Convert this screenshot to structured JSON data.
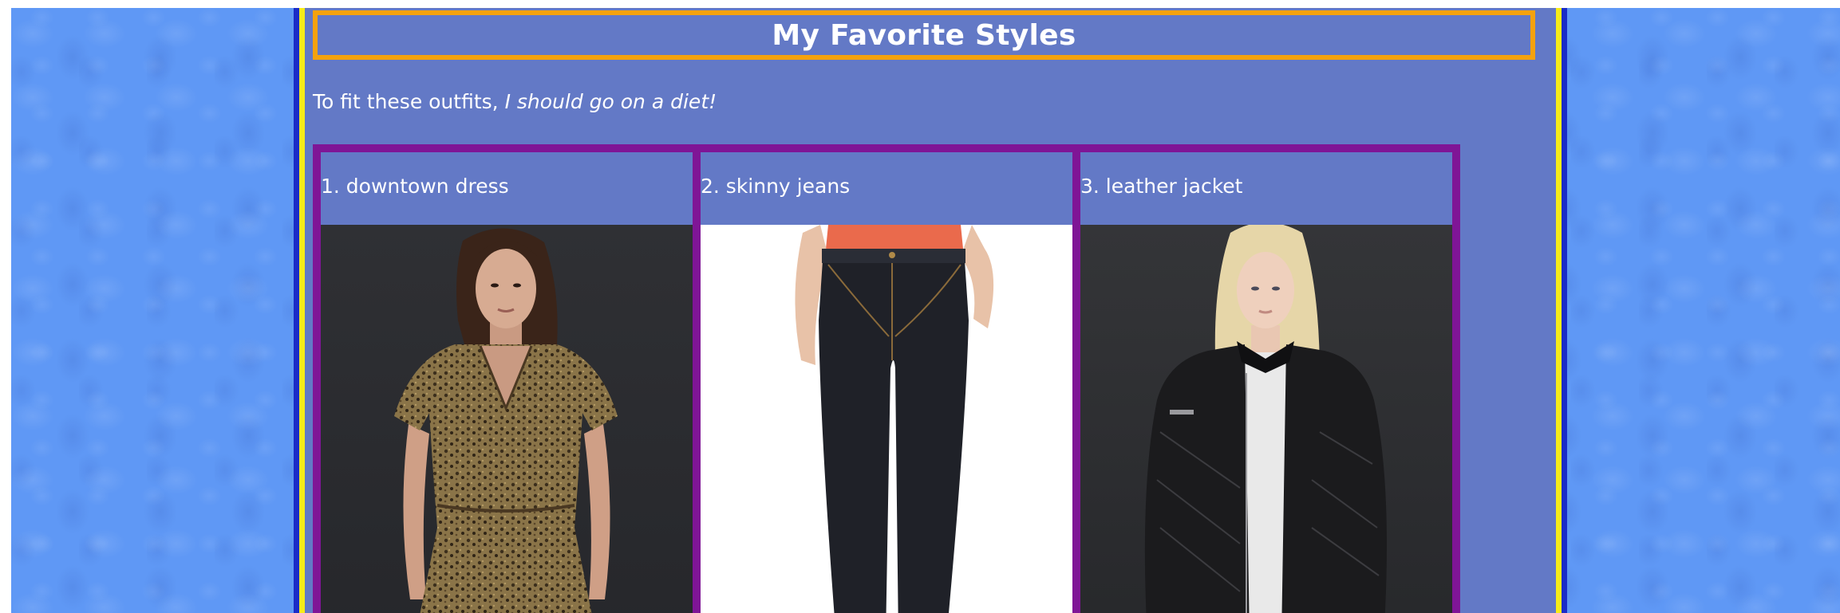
{
  "page": {
    "title": "My Favorite Styles",
    "intro_text": "To fit these outfits,",
    "intro_emphasis": "I should go on a diet!"
  },
  "items": [
    {
      "label": "1. downtown dress",
      "image": "woman-in-leopard-print-dress-photo"
    },
    {
      "label": "2. skinny jeans",
      "image": "dark-skinny-jeans-photo"
    },
    {
      "label": "3. leather jacket",
      "image": "woman-in-black-leather-jacket-photo"
    }
  ],
  "colors": {
    "page_background": "#5f98f5",
    "outer_border": "#1a2cc8",
    "yellow_border": "#f7ec18",
    "panel": "#6379c6",
    "title_border": "#f4a20e",
    "cell_border": "#7f1596"
  }
}
